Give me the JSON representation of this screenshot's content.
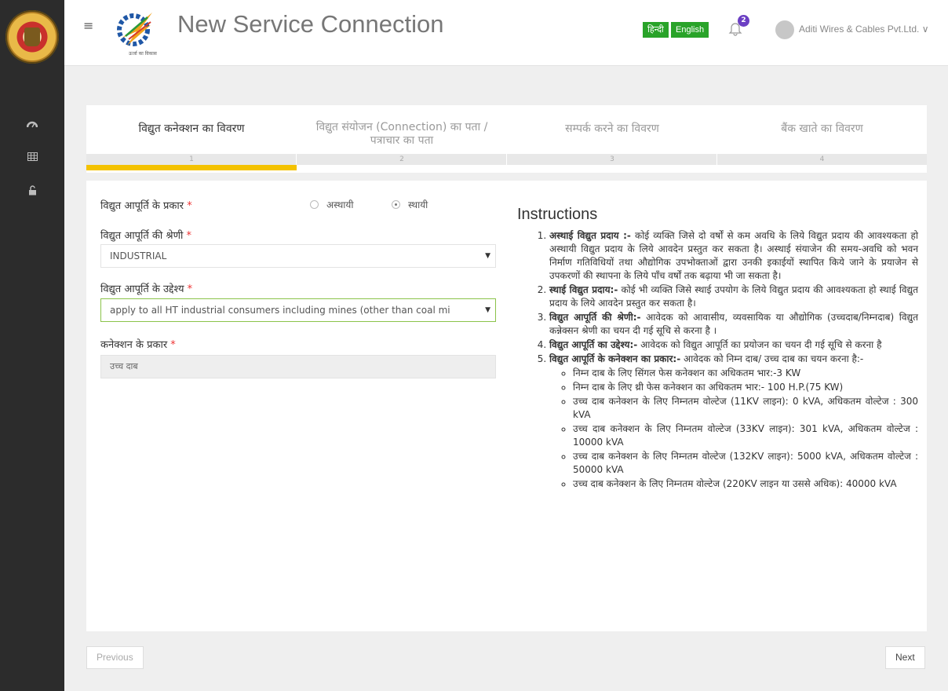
{
  "header": {
    "title": "New Service Connection",
    "brand_tagline": "ऊर्जा का विकास",
    "lang_hindi": "हिन्दी",
    "lang_english": "English",
    "notification_count": "2",
    "user_name": "Aditi Wires & Cables Pvt.Ltd. ∨"
  },
  "sidebar": {
    "items": [
      {
        "icon": "dashboard-icon"
      },
      {
        "icon": "grid-icon"
      },
      {
        "icon": "unlock-icon"
      }
    ]
  },
  "steps": [
    {
      "title": "विद्युत कनेक्शन का विवरण",
      "num": "1"
    },
    {
      "title": "विद्युत संयोजन (Connection) का पता / पत्राचार का पता",
      "num": "2"
    },
    {
      "title": "सम्पर्क करने का विवरण",
      "num": "3"
    },
    {
      "title": "बैंक खाते का विवरण",
      "num": "4"
    }
  ],
  "form": {
    "supply_type_label": "विद्युत आपूर्ति के प्रकार",
    "supply_type_options": [
      "अस्थायी",
      "स्थायी"
    ],
    "supply_type_selected": "स्थायी",
    "category_label": "विद्युत आपूर्ति की श्रेणी",
    "category_value": "INDUSTRIAL",
    "purpose_label": "विद्युत आपूर्ति के उद्देश्य",
    "purpose_value": "apply to all HT industrial consumers including mines (other than coal mi",
    "connection_type_label": "कनेक्शन के प्रकार",
    "connection_type_value": "उच्च दाब",
    "required_mark": "*"
  },
  "instructions": {
    "title": "Instructions",
    "items": [
      {
        "head": "अस्थाई विद्युत प्रदाय :-",
        "text": " कोई व्यक्ति जिसे दो वर्षों से कम अवधि के लिये विद्युत प्रदाय की आवश्यकता हो अस्थायी विद्युत प्रदाय के लिये आवदेन प्रस्तुत कर सकता है। अस्थाई संयाजेन की समय-अवधि को भवन निर्माण गतिविधियों तथा औद्योगिक उपभोक्ताओं द्वारा उनकी इकाईयों स्थापित किये जाने के प्रयाजेन से उपकरणों की स्थापना के लिये पाँच वर्षों तक बढ़ाया भी जा सकता है।"
      },
      {
        "head": "स्थाई विद्युत प्रदाय:-",
        "text": " कोई भी व्यक्ति जिसे स्थाई उपयोग के लिये विद्युत प्रदाय की आवश्यकता हो स्थाई विद्युत प्रदाय के लिये आवदेन प्रस्तुत कर सकता है।"
      },
      {
        "head": "विद्युत आपूर्ति की श्रेणी:-",
        "text": " आवेदक को आवासीय, व्यवसायिक या औद्योगिक (उच्चदाब/निम्नदाब) विद्युत कन्नेक्सन श्रेणी का चयन दी गई सूचि से करना है ।"
      },
      {
        "head": "विद्युत आपूर्ति का उद्देश्य:-",
        "text": " आवेदक को विद्युत आपूर्ति का प्रयोजन का चयन दी गई सूचि से करना है"
      },
      {
        "head": "विद्युत आपूर्ति के कनेक्शन का प्रकार:-",
        "text": " आवेदक को निम्न दाब/ उच्च दाब का चयन करना है:-"
      }
    ],
    "sub_items": [
      "निम्न दाब के लिए सिंगल फेस कनेक्शन का अधिकतम भार:-3 KW",
      "निम्न दाब के लिए थ्री फेस कनेक्शन का अधिकतम भार:- 100 H.P.(75 KW)",
      "उच्च दाब कनेक्शन के लिए निम्नतम वोल्टेज (11KV लाइन): 0 kVA, अधिकतम वोल्टेज : 300 kVA",
      "उच्च दाब कनेक्शन के लिए निम्नतम वोल्टेज (33KV लाइन): 301 kVA, अधिकतम वोल्टेज : 10000 kVA",
      "उच्च दाब कनेक्शन के लिए निम्नतम वोल्टेज (132KV लाइन): 5000 kVA, अधिकतम वोल्टेज : 50000 kVA",
      "उच्च दाब कनेक्शन के लिए निम्नतम वोल्टेज (220KV लाइन या उससे अधिक): 40000 kVA"
    ]
  },
  "nav": {
    "previous_label": "Previous",
    "next_label": "Next"
  },
  "colors": {
    "sidebar_bg": "#2c2c2c",
    "lang_button": "#29a329",
    "progress_active": "#f4c200",
    "badge": "#6b3fc3",
    "required": "#ee3333"
  }
}
